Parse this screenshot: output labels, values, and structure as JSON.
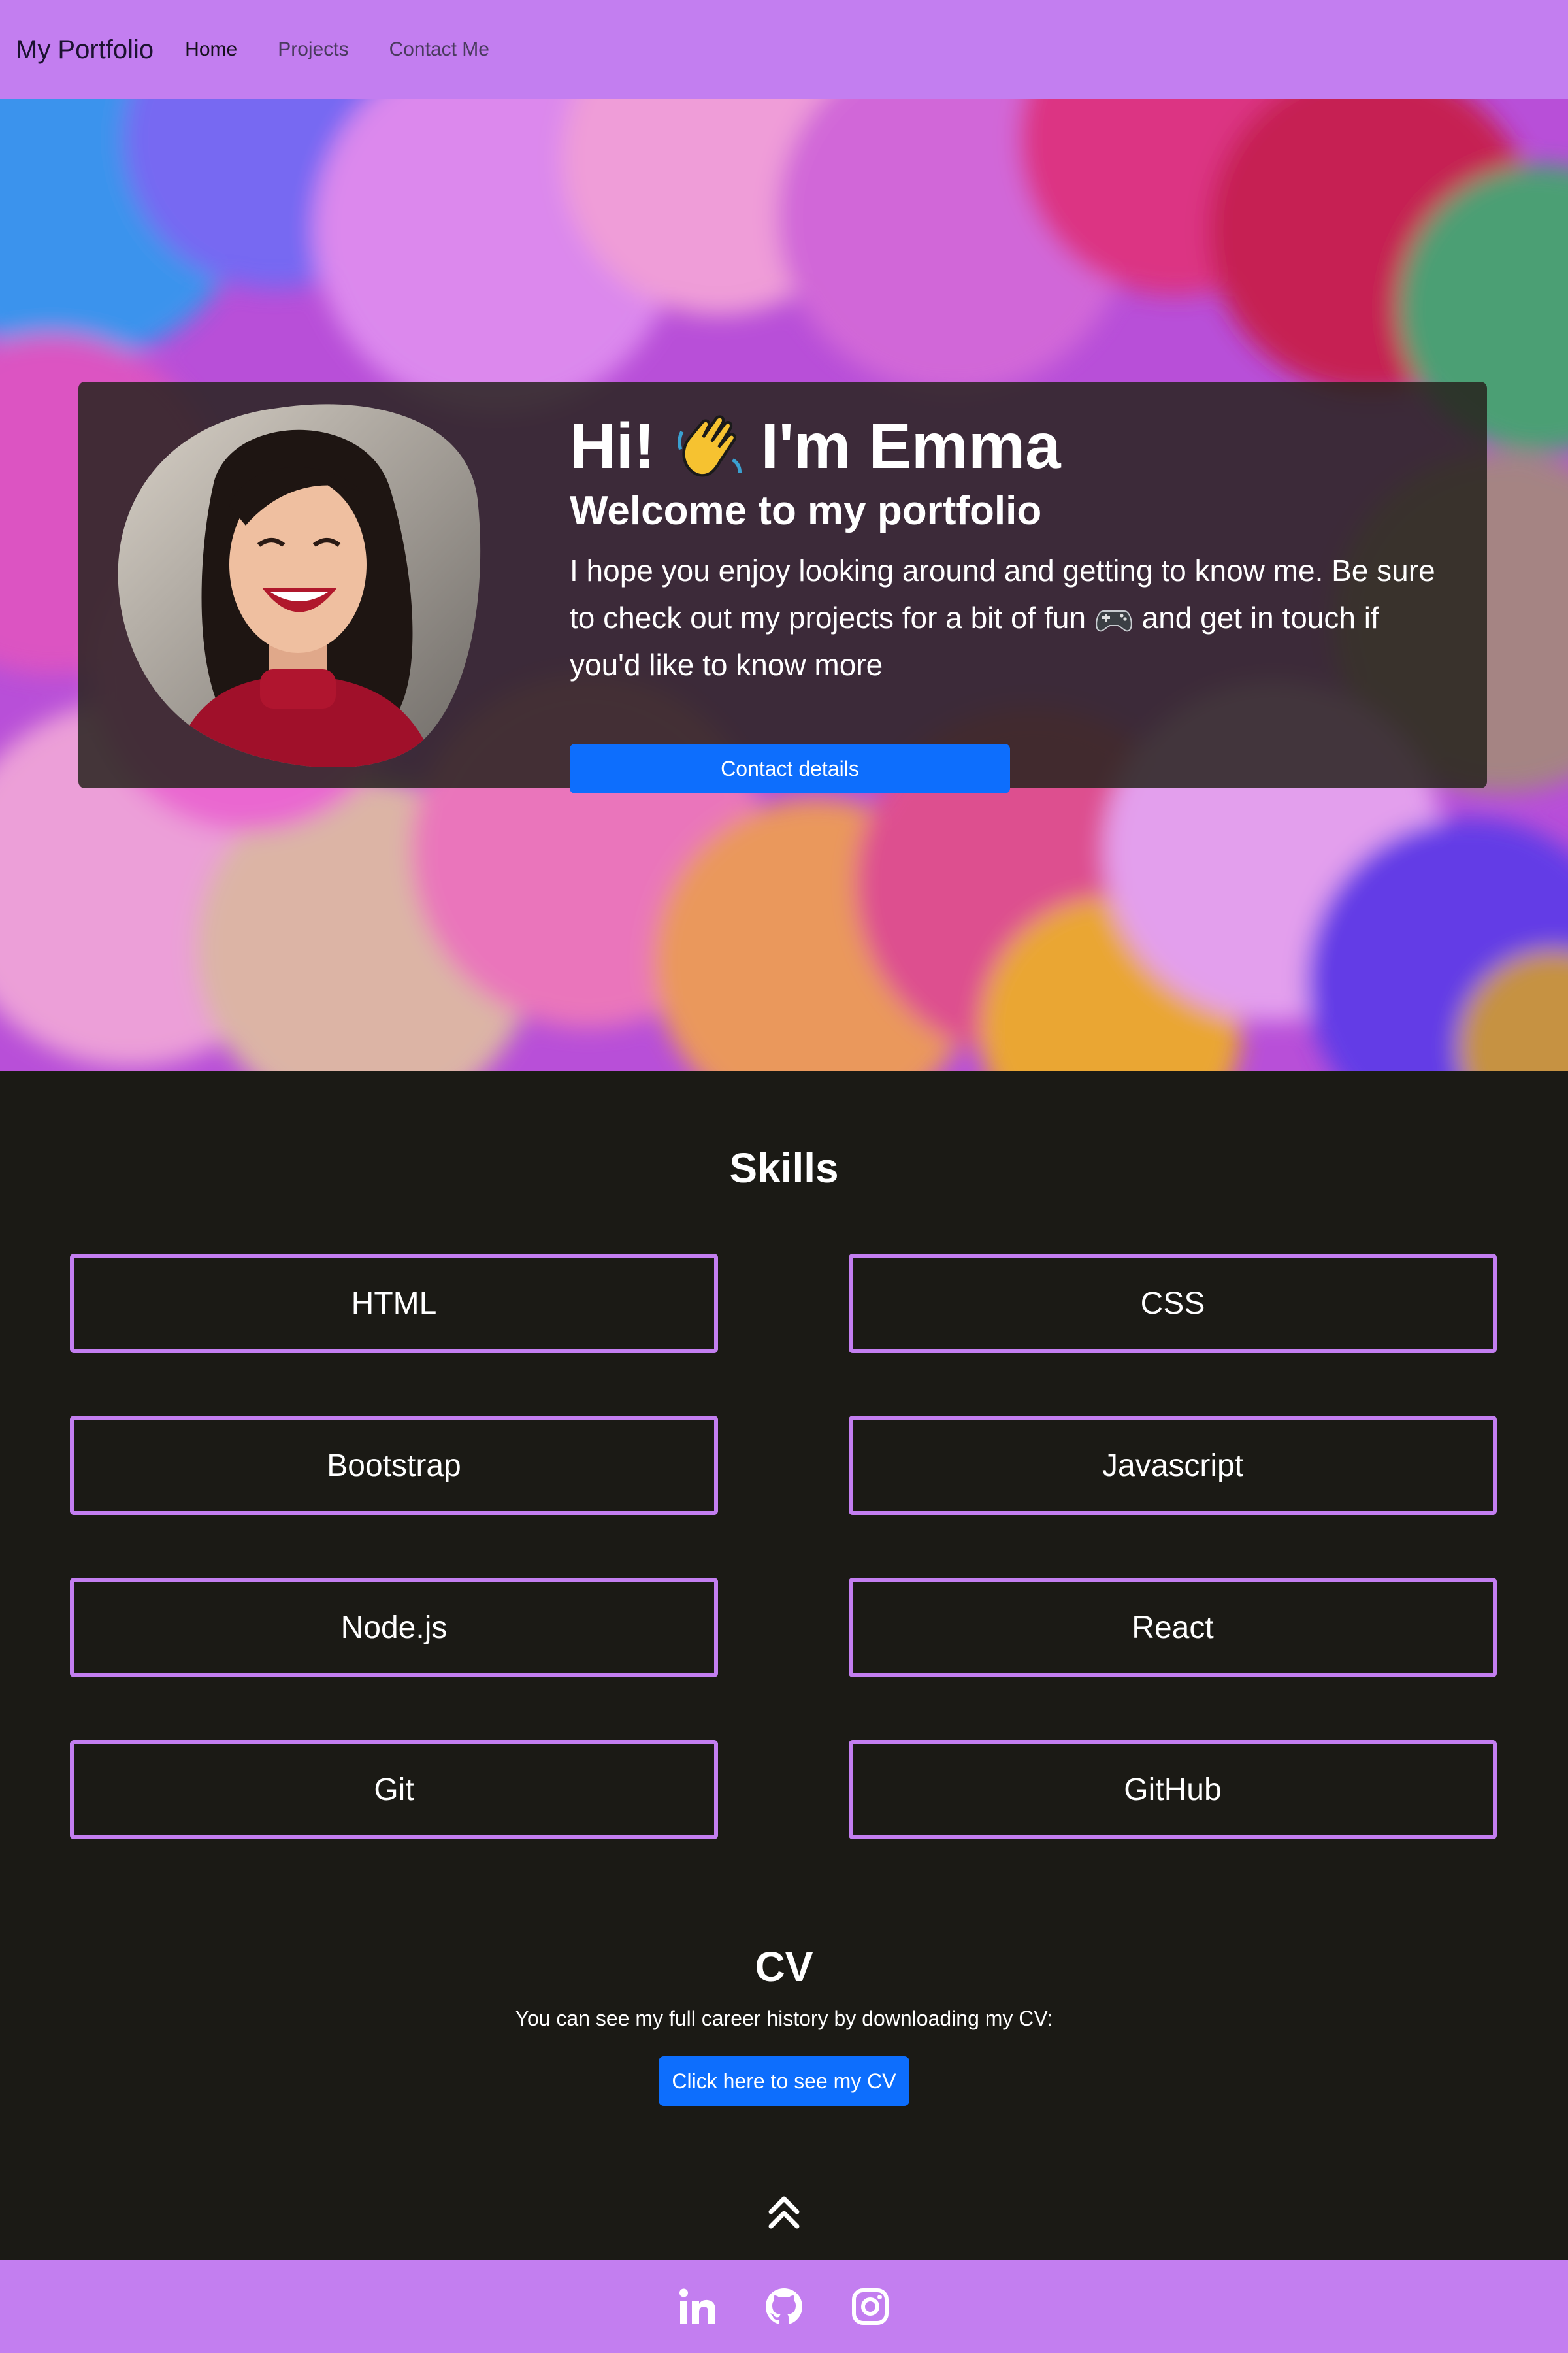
{
  "navbar": {
    "brand": "My Portfolio",
    "links": [
      {
        "label": "Home"
      },
      {
        "label": "Projects"
      },
      {
        "label": "Contact Me"
      }
    ]
  },
  "hero": {
    "greeting_start": "Hi!",
    "greeting_end": "I'm Emma",
    "wave_icon": "waving-hand-icon",
    "subtitle": "Welcome to my portfolio",
    "paragraph_part1": "I hope you enjoy looking around and getting to know me. Be sure to check out my projects for a bit of fun",
    "gamepad_icon": "game-controller-icon",
    "paragraph_part2": "and get in touch if you'd like to know more",
    "button_label": "Contact details"
  },
  "skills": {
    "title": "Skills",
    "items": [
      "HTML",
      "CSS",
      "Bootstrap",
      "Javascript",
      "Node.js",
      "React",
      "Git",
      "GitHub"
    ]
  },
  "cv": {
    "title": "CV",
    "text": "You can see my full career history by downloading my CV:",
    "button_label": "Click here to see my CV"
  },
  "back_to_top_icon": "double-chevron-up-icon",
  "footer": {
    "icons": [
      "linkedin-icon",
      "github-icon",
      "instagram-icon"
    ]
  },
  "colors": {
    "accent_purple": "#c37ef0",
    "button_blue": "#0d6efd",
    "dark_background": "#1b1a15"
  }
}
